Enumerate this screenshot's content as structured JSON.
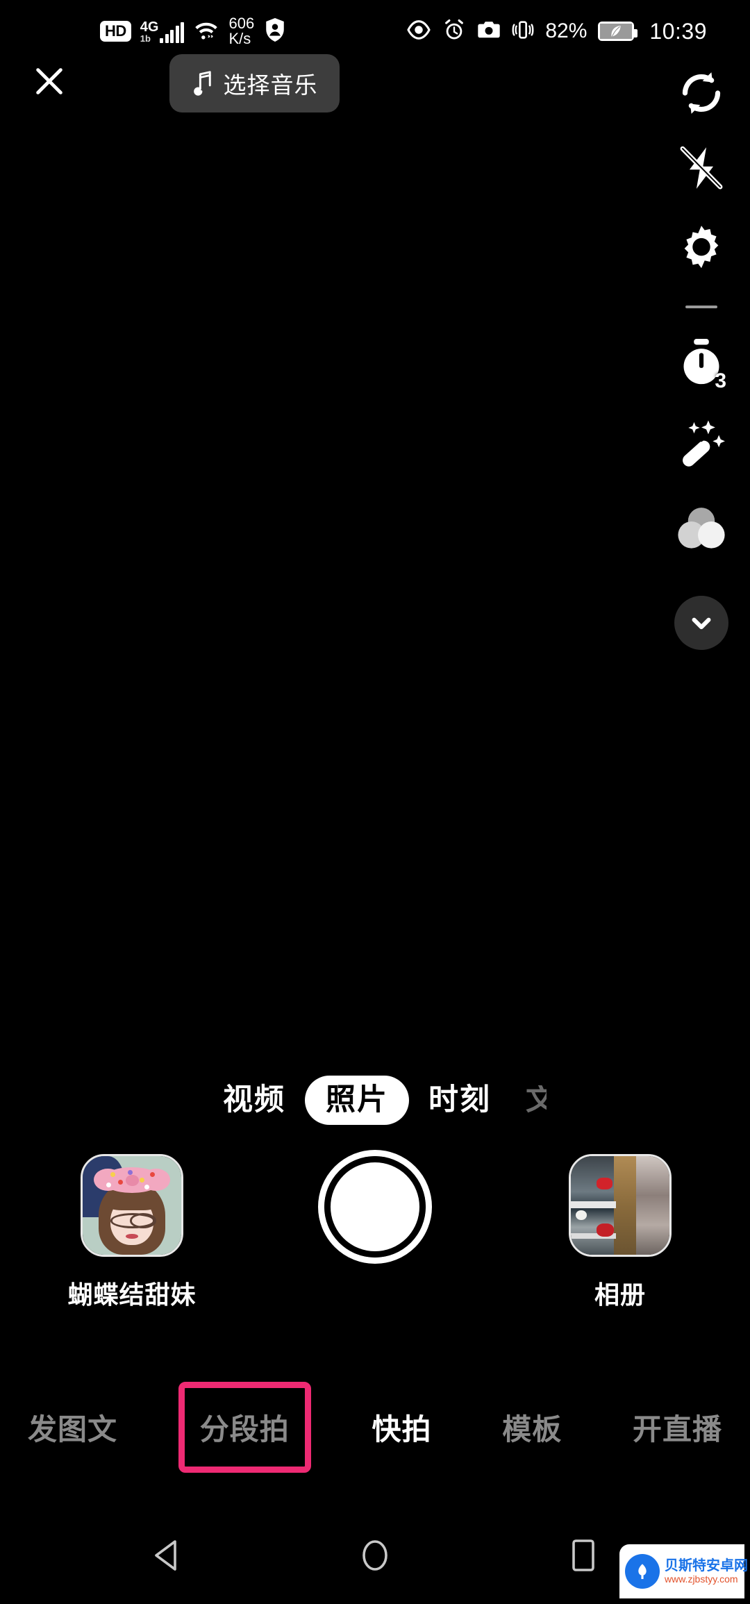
{
  "status_bar": {
    "hd_badge": "HD",
    "network_type": "4G",
    "network_sub": "1b",
    "speed_value": "606",
    "speed_unit": "K/s",
    "battery_percent": "82%",
    "clock": "10:39",
    "icons": [
      "hd-icon",
      "signal-icon",
      "wifi-icon",
      "vpn-shield-icon",
      "eye-comfort-icon",
      "alarm-icon",
      "camera-icon",
      "vibrate-icon",
      "battery-icon"
    ]
  },
  "topbar": {
    "close_label": "✕",
    "music_label": "选择音乐",
    "music_icon": "music-note-icon"
  },
  "sidebar": {
    "items": [
      {
        "name": "flip-camera",
        "icon": "flip-camera-icon",
        "label": ""
      },
      {
        "name": "flash-off",
        "icon": "flash-off-icon",
        "label": ""
      },
      {
        "name": "settings",
        "icon": "gear-icon",
        "label": ""
      },
      {
        "name": "timer",
        "icon": "timer-icon",
        "label": "3"
      },
      {
        "name": "beauty",
        "icon": "magic-wand-icon",
        "label": ""
      },
      {
        "name": "filters",
        "icon": "filter-circles-icon",
        "label": ""
      },
      {
        "name": "collapse",
        "icon": "chevron-down-icon",
        "label": ""
      }
    ],
    "timer_value": "3"
  },
  "modes": [
    {
      "label": "视频",
      "state": "normal"
    },
    {
      "label": "照片",
      "state": "selected"
    },
    {
      "label": "时刻",
      "state": "normal"
    },
    {
      "label": "文",
      "state": "clipped"
    }
  ],
  "capture": {
    "effect": {
      "label": "蝴蝶结甜妹",
      "thumb": "bow-cute-girl-effect-thumbnail"
    },
    "shutter": {
      "name": "shutter-button"
    },
    "album": {
      "label": "相册",
      "thumb": "last-photo-thumbnail"
    }
  },
  "tabs": [
    {
      "label": "发图文",
      "state": "inactive"
    },
    {
      "label": "分段拍",
      "state": "highlight"
    },
    {
      "label": "快拍",
      "state": "active"
    },
    {
      "label": "模板",
      "state": "inactive"
    },
    {
      "label": "开直播",
      "state": "inactive"
    }
  ],
  "navbar": [
    {
      "name": "back-button",
      "icon": "triangle-back-icon"
    },
    {
      "name": "home-button",
      "icon": "circle-home-icon"
    },
    {
      "name": "recents-button",
      "icon": "square-recents-icon"
    }
  ],
  "watermark": {
    "title": "贝斯特安卓网",
    "url": "www.zjbstyy.com",
    "logo": "bst-logo-icon"
  },
  "colors": {
    "background": "#000000",
    "accent_pink": "#ee2a73",
    "active_text": "#ffffff",
    "inactive_text": "#8a8a8a",
    "chip_bg": "#3d3d3d"
  }
}
